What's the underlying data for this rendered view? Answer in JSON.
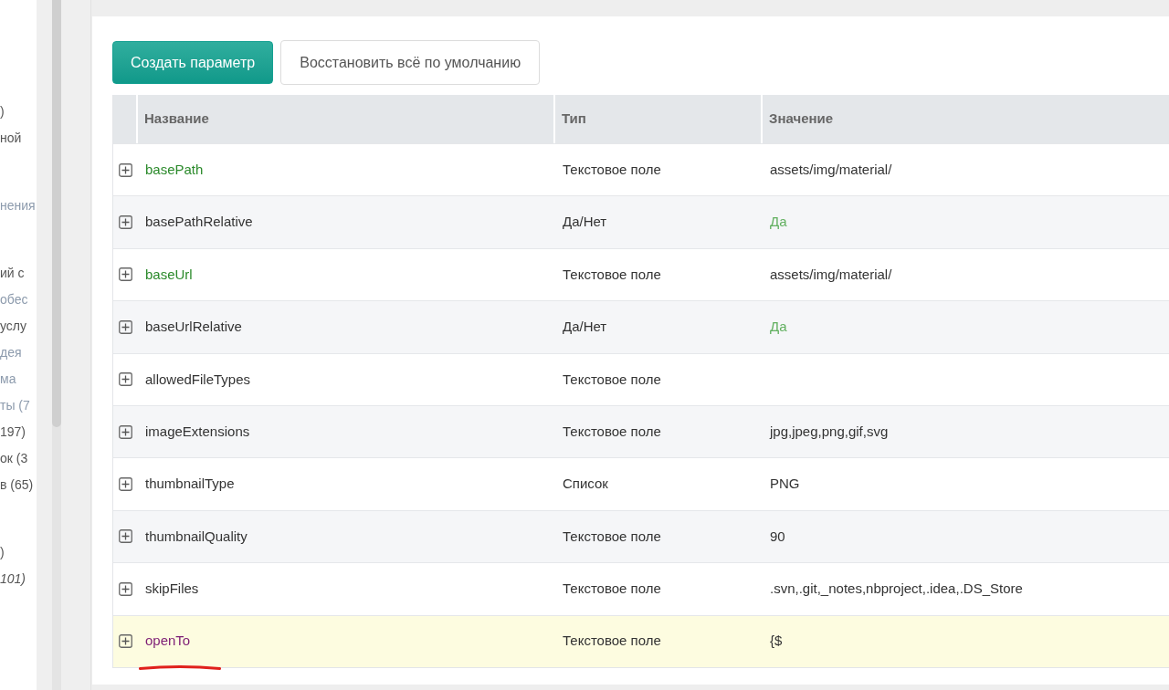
{
  "sidebar": {
    "groups": [
      {
        "items": [
          {
            "text": ")",
            "kind": "normal"
          },
          {
            "text": "ной",
            "kind": "normal"
          }
        ]
      },
      {
        "items": [
          {
            "text": "нения",
            "kind": "muted"
          }
        ]
      },
      {
        "items": [
          {
            "text": "ий с",
            "kind": "normal"
          },
          {
            "text": "обес",
            "kind": "muted"
          },
          {
            "text": "услу",
            "kind": "normal"
          },
          {
            "text": "дея",
            "kind": "muted"
          },
          {
            "text": "ма",
            "kind": "muted"
          },
          {
            "text": "ты (7",
            "kind": "muted"
          },
          {
            "text": "197)",
            "kind": "normal"
          },
          {
            "text": "ок (3",
            "kind": "normal"
          },
          {
            "text": "в (65)",
            "kind": "normal"
          }
        ]
      },
      {
        "items": [
          {
            "text": ")",
            "kind": "normal"
          },
          {
            "text": "101)",
            "kind": "italic"
          }
        ]
      }
    ]
  },
  "toolbar": {
    "buttons": [
      {
        "label": "Создать параметр",
        "kind": "primary"
      },
      {
        "label": "Восстановить всё по умолчанию",
        "kind": "default"
      }
    ]
  },
  "table": {
    "columns": [
      "Название",
      "Тип",
      "Значение"
    ],
    "rows": [
      {
        "name": "basePath",
        "type": "Текстовое поле",
        "value": "assets/img/material/",
        "kind": "text",
        "color": "#2b8a2b",
        "selected": false,
        "annotated": false
      },
      {
        "name": "basePathRelative",
        "type": "Да/Нет",
        "value": "Да",
        "kind": "boolean",
        "color": "#333333",
        "selected": false,
        "annotated": false
      },
      {
        "name": "baseUrl",
        "type": "Текстовое поле",
        "value": "assets/img/material/",
        "kind": "text",
        "color": "#2b8a2b",
        "selected": false,
        "annotated": false
      },
      {
        "name": "baseUrlRelative",
        "type": "Да/Нет",
        "value": "Да",
        "kind": "boolean",
        "color": "#333333",
        "selected": false,
        "annotated": false
      },
      {
        "name": "allowedFileTypes",
        "type": "Текстовое поле",
        "color": "#333333",
        "selected": false,
        "annotated": false
      },
      {
        "name": "imageExtensions",
        "type": "Текстовое поле",
        "value": "jpg,jpeg,png,gif,svg",
        "kind": "text",
        "color": "#333333",
        "selected": false,
        "annotated": false
      },
      {
        "name": "thumbnailType",
        "type": "Список",
        "value": "PNG",
        "kind": "list",
        "color": "#333333",
        "selected": false,
        "annotated": false
      },
      {
        "name": "thumbnailQuality",
        "type": "Текстовое поле",
        "value": "90",
        "kind": "text",
        "color": "#333333",
        "selected": false,
        "annotated": false
      },
      {
        "name": "skipFiles",
        "type": "Текстовое поле",
        "value": ".svn,.git,_notes,nbproject,.idea,.DS_Store",
        "kind": "text",
        "color": "#333333",
        "selected": false,
        "annotated": false
      },
      {
        "name": "openTo",
        "type": "Текстовое поле",
        "value": "{$",
        "kind": "text",
        "color": "#7d1d75",
        "selected": true,
        "annotated": true
      }
    ]
  }
}
